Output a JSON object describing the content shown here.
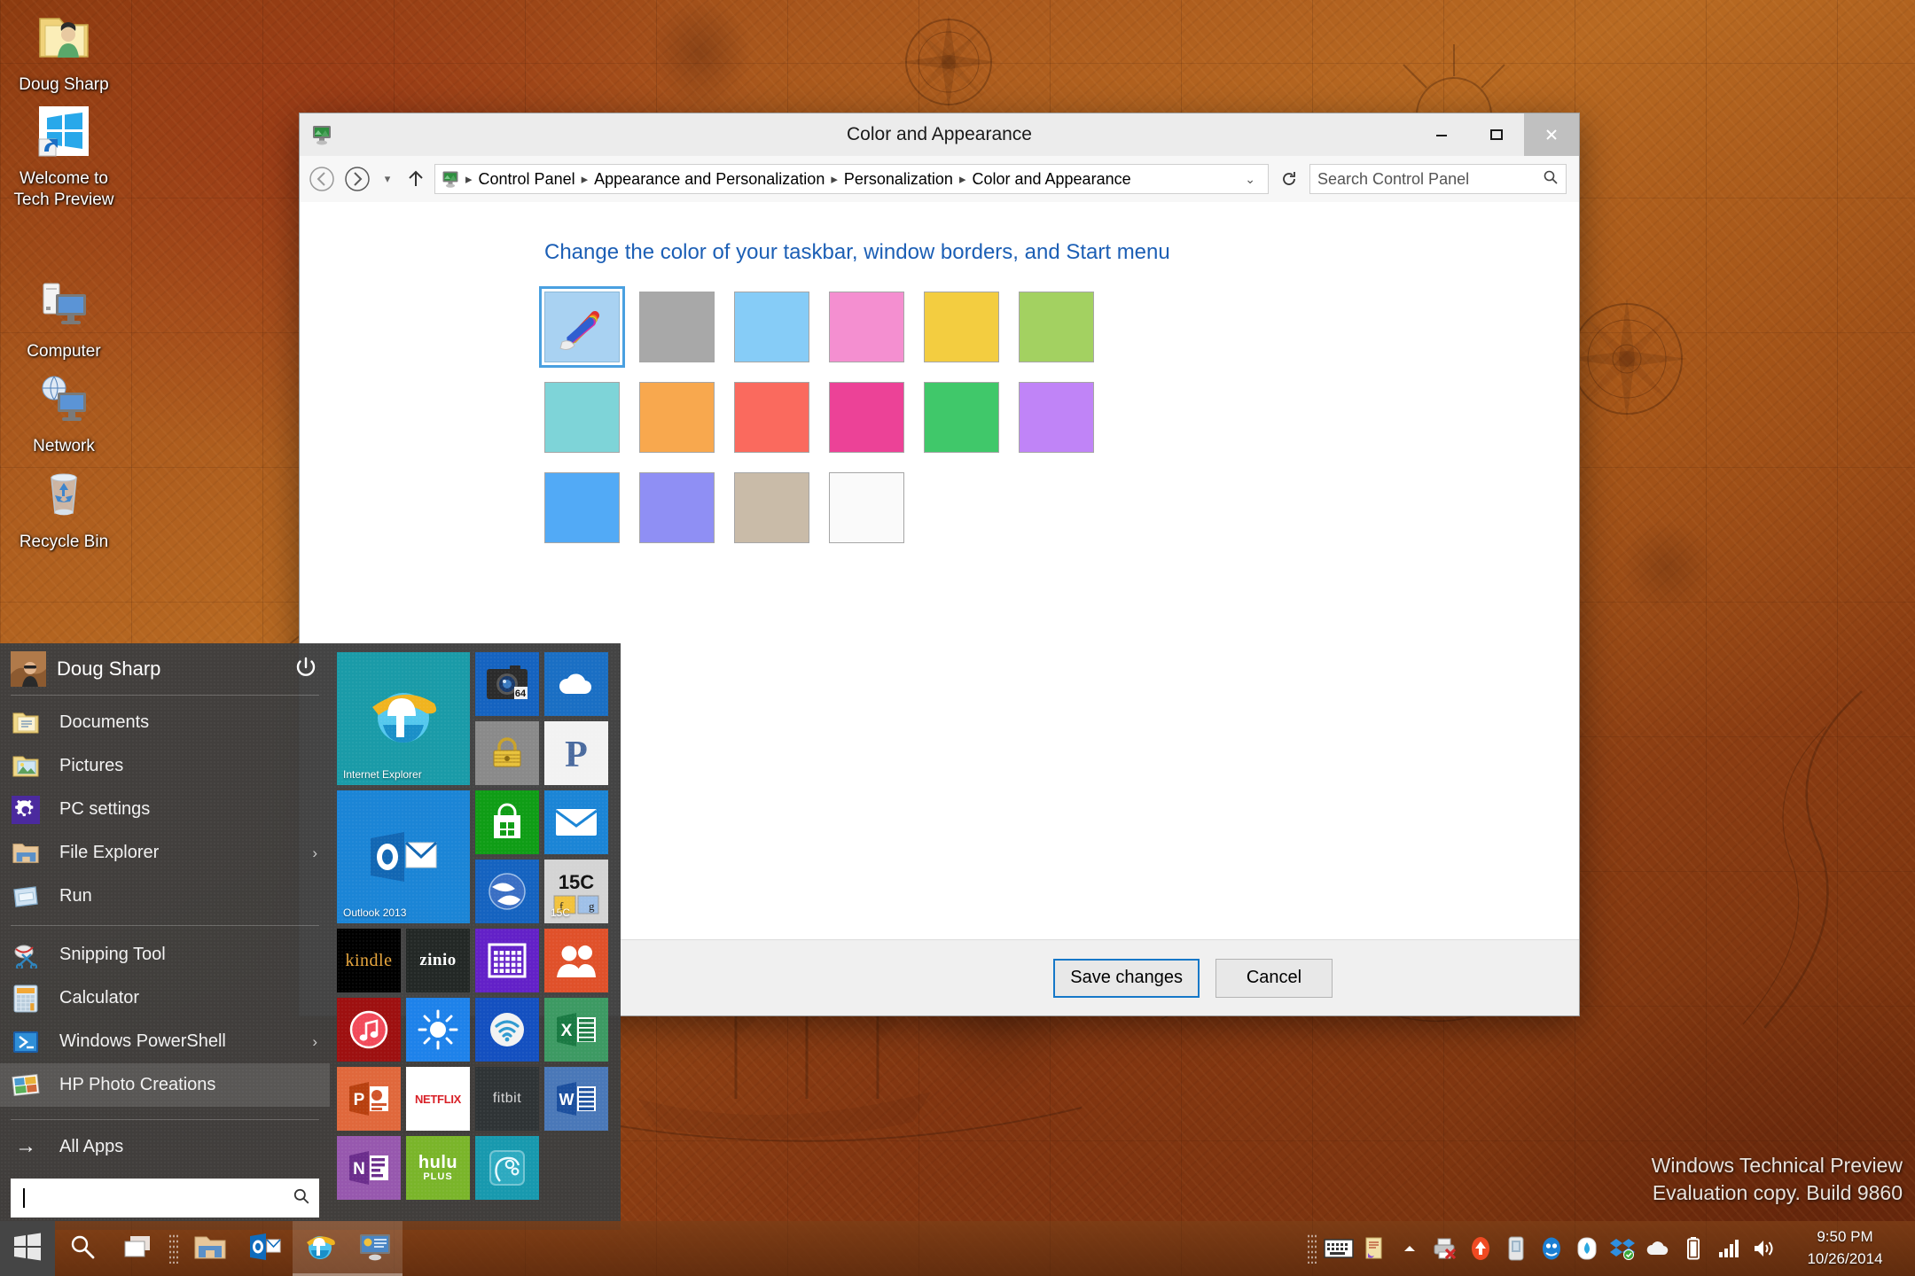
{
  "desktop": {
    "icons": [
      {
        "name": "user-folder",
        "label": "Doug Sharp",
        "icon": "user-folder-icon"
      },
      {
        "name": "welcome",
        "label": "Welcome to\nTech Preview",
        "icon": "windows-shortcut-icon"
      },
      {
        "name": "computer",
        "label": "Computer",
        "icon": "computer-icon"
      },
      {
        "name": "network",
        "label": "Network",
        "icon": "network-icon"
      },
      {
        "name": "recycle-bin",
        "label": "Recycle Bin",
        "icon": "recycle-bin-icon"
      }
    ],
    "watermark": {
      "line1": "Windows Technical Preview",
      "line2": "Evaluation copy. Build 9860"
    }
  },
  "window": {
    "title": "Color and Appearance",
    "title_icon": "personalization-icon",
    "controls": {
      "minimize": "minimize-icon",
      "maximize": "maximize-icon",
      "close": "close-icon"
    },
    "address": {
      "back": "back-arrow-icon",
      "forward": "forward-arrow-icon",
      "recent": "chevron-down-icon",
      "up": "up-arrow-icon",
      "crumb_icon": "control-panel-icon",
      "breadcrumbs": [
        "Control Panel",
        "Appearance and Personalization",
        "Personalization",
        "Color and Appearance"
      ],
      "dropdown": "chevron-down-icon",
      "refresh": "refresh-icon"
    },
    "search": {
      "placeholder": "Search Control Panel",
      "icon": "search-icon"
    },
    "content": {
      "heading": "Change the color of your taskbar, window borders, and Start menu",
      "swatches": [
        {
          "name": "automatic",
          "type": "auto",
          "color": "#a9d2f2",
          "selected": true
        },
        {
          "name": "gray",
          "type": "color",
          "color": "#a8a8a8",
          "selected": false
        },
        {
          "name": "light-blue",
          "type": "color",
          "color": "#86ccf7",
          "selected": false
        },
        {
          "name": "pink",
          "type": "color",
          "color": "#f48fd0",
          "selected": false
        },
        {
          "name": "yellow",
          "type": "color",
          "color": "#f3cd40",
          "selected": false
        },
        {
          "name": "lime-green",
          "type": "color",
          "color": "#a3d161",
          "selected": false
        },
        {
          "name": "turquoise",
          "type": "color",
          "color": "#7ed4d8",
          "selected": false
        },
        {
          "name": "orange",
          "type": "color",
          "color": "#f8a84e",
          "selected": false
        },
        {
          "name": "salmon-red",
          "type": "color",
          "color": "#fa6a5e",
          "selected": false
        },
        {
          "name": "magenta",
          "type": "color",
          "color": "#ec4297",
          "selected": false
        },
        {
          "name": "green",
          "type": "color",
          "color": "#40c86a",
          "selected": false
        },
        {
          "name": "violet",
          "type": "color",
          "color": "#c084f7",
          "selected": false
        },
        {
          "name": "blue",
          "type": "color",
          "color": "#52aaf6",
          "selected": false
        },
        {
          "name": "periwinkle",
          "type": "color",
          "color": "#8f8ff4",
          "selected": false
        },
        {
          "name": "taupe",
          "type": "color",
          "color": "#c9bba8",
          "selected": false
        },
        {
          "name": "white",
          "type": "color",
          "color": "#fafafa",
          "selected": false
        }
      ]
    },
    "footer": {
      "save_label": "Save changes",
      "cancel_label": "Cancel"
    }
  },
  "start_menu": {
    "user": {
      "name": "Doug Sharp",
      "avatar": "user-avatar",
      "power_icon": "power-icon"
    },
    "items": [
      {
        "label": "Documents",
        "icon": "documents-folder-icon",
        "chevron": false,
        "highlight": false
      },
      {
        "label": "Pictures",
        "icon": "pictures-folder-icon",
        "chevron": false,
        "highlight": false
      },
      {
        "label": "PC settings",
        "icon": "pc-settings-gear-icon",
        "chevron": false,
        "highlight": false
      },
      {
        "label": "File Explorer",
        "icon": "file-explorer-icon",
        "chevron": true,
        "highlight": false
      },
      {
        "label": "Run",
        "icon": "run-icon",
        "chevron": false,
        "highlight": false
      },
      {
        "label": "Snipping Tool",
        "icon": "snipping-tool-icon",
        "chevron": false,
        "highlight": false
      },
      {
        "label": "Calculator",
        "icon": "calculator-icon",
        "chevron": false,
        "highlight": false
      },
      {
        "label": "Windows PowerShell",
        "icon": "powershell-icon",
        "chevron": true,
        "highlight": false
      },
      {
        "label": "HP Photo Creations",
        "icon": "hp-photo-creations-icon",
        "chevron": false,
        "highlight": true
      }
    ],
    "all_apps": {
      "label": "All Apps",
      "icon": "arrow-right-icon"
    },
    "search": {
      "value": "",
      "placeholder": "",
      "icon": "search-icon"
    },
    "tiles": [
      {
        "name": "internet-explorer",
        "label": "Internet Explorer",
        "color": "#1a9ba8",
        "icon": "ie-icon",
        "wide": true
      },
      {
        "name": "camera-64",
        "label": "",
        "color": "#1563c0",
        "icon": "camera64-icon",
        "wide": false
      },
      {
        "name": "onedrive",
        "label": "",
        "color": "#1a6fc4",
        "icon": "cloud-icon",
        "wide": false
      },
      {
        "name": "secure-vault",
        "label": "",
        "color": "#8a8a8a",
        "icon": "lock-icon",
        "wide": false
      },
      {
        "name": "pandora",
        "label": "",
        "color": "#f2f2f2",
        "icon": "pandora-p-icon",
        "wide": false
      },
      {
        "name": "outlook-2013",
        "label": "Outlook 2013",
        "color": "#1b85d6",
        "icon": "outlook-icon",
        "wide": true
      },
      {
        "name": "store",
        "label": "",
        "color": "#0f9d16",
        "icon": "store-bag-icon",
        "wide": false
      },
      {
        "name": "mail",
        "label": "",
        "color": "#1b85d6",
        "icon": "envelope-icon",
        "wide": false
      },
      {
        "name": "google-earth",
        "label": "",
        "color": "#1563c0",
        "icon": "globe-icon",
        "wide": false
      },
      {
        "name": "calculator-15c",
        "label": "15C",
        "color": "#d4d4d4",
        "icon": "calc15c-icon",
        "wide": false
      },
      {
        "name": "kindle",
        "label": "kindle",
        "color": "#000000",
        "icon": "text-icon",
        "wide": false
      },
      {
        "name": "zinio",
        "label": "zinio",
        "color": "#232826",
        "icon": "text-icon",
        "wide": false
      },
      {
        "name": "calendar",
        "label": "",
        "color": "#6321c8",
        "icon": "calendar-icon",
        "wide": false
      },
      {
        "name": "people",
        "label": "",
        "color": "#e0512a",
        "icon": "people-icon",
        "wide": false
      },
      {
        "name": "itunes",
        "label": "",
        "color": "#9e1010",
        "icon": "music-note-icon",
        "wide": false
      },
      {
        "name": "weather",
        "label": "",
        "color": "#1e82ea",
        "icon": "sun-icon",
        "wide": false
      },
      {
        "name": "wifi-analyzer",
        "label": "",
        "color": "#1450c0",
        "icon": "wifi-icon",
        "wide": false
      },
      {
        "name": "excel",
        "label": "",
        "color": "#3d9a63",
        "icon": "excel-x-icon",
        "wide": false
      },
      {
        "name": "powerpoint",
        "label": "",
        "color": "#e0683c",
        "icon": "ppt-p-icon",
        "wide": false
      },
      {
        "name": "netflix",
        "label": "NETFLIX",
        "color": "#ffffff",
        "icon": "text-icon",
        "wide": false
      },
      {
        "name": "fitbit",
        "label": "fitbit",
        "color": "#2f3436",
        "icon": "text-icon",
        "wide": false
      },
      {
        "name": "word",
        "label": "",
        "color": "#4a78b8",
        "icon": "word-w-icon",
        "wide": false
      },
      {
        "name": "onenote",
        "label": "",
        "color": "#9758ae",
        "icon": "onenote-n-icon",
        "wide": false
      },
      {
        "name": "hulu-plus",
        "label": "hulu",
        "sublabel": "PLUS",
        "color": "#7ab52a",
        "icon": "text-icon",
        "wide": false
      },
      {
        "name": "mind-app",
        "label": "",
        "color": "#1899ae",
        "icon": "head-gear-icon",
        "wide": false
      }
    ]
  },
  "taskbar": {
    "start": "windows-logo-icon",
    "buttons": [
      {
        "name": "search",
        "icon": "search-icon",
        "active": false
      },
      {
        "name": "task-view",
        "icon": "task-view-icon",
        "active": false
      },
      {
        "name": "file-explorer",
        "icon": "file-explorer-icon",
        "active": false
      },
      {
        "name": "outlook",
        "icon": "outlook-icon",
        "active": false
      },
      {
        "name": "internet-explorer",
        "icon": "ie-icon",
        "active": true
      },
      {
        "name": "control-panel",
        "icon": "control-panel-icon",
        "active": true
      }
    ],
    "tray": [
      {
        "name": "touch-keyboard",
        "icon": "keyboard-icon"
      },
      {
        "name": "notepad-tray",
        "icon": "note-icon"
      },
      {
        "name": "show-hidden",
        "icon": "chevron-up-icon"
      },
      {
        "name": "printer",
        "icon": "printer-error-icon"
      },
      {
        "name": "updates",
        "icon": "up-arrow-circle-icon"
      },
      {
        "name": "battery-tool",
        "icon": "device-icon"
      },
      {
        "name": "antivirus",
        "icon": "shield-blue-icon"
      },
      {
        "name": "backup",
        "icon": "drop-icon"
      },
      {
        "name": "dropbox",
        "icon": "dropbox-icon"
      },
      {
        "name": "onedrive-tray",
        "icon": "cloud-icon"
      },
      {
        "name": "battery",
        "icon": "battery-icon"
      },
      {
        "name": "network-signal",
        "icon": "signal-bars-icon"
      },
      {
        "name": "volume",
        "icon": "speaker-icon"
      }
    ],
    "clock": {
      "time": "9:50 PM",
      "date": "10/26/2014"
    }
  }
}
